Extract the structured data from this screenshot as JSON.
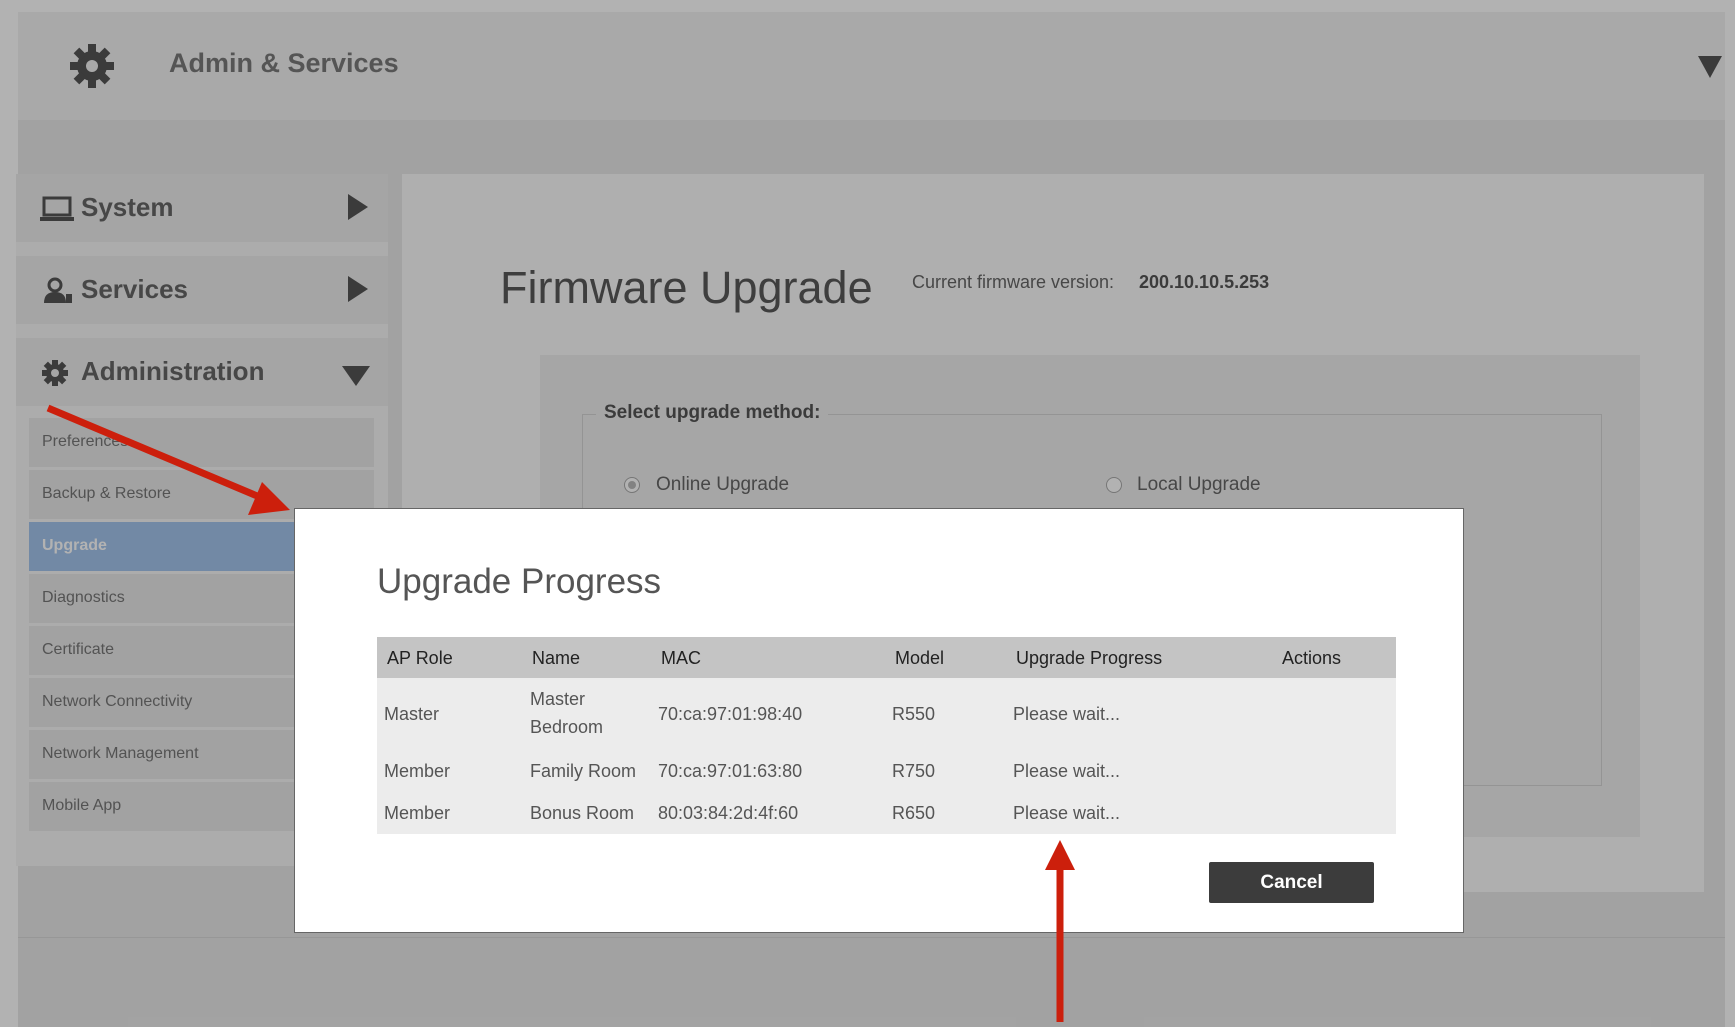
{
  "header": {
    "title": "Admin & Services",
    "icon": "gear-icon"
  },
  "sidebar": {
    "sections": [
      {
        "label": "System",
        "icon": "laptop-icon",
        "expanded": false
      },
      {
        "label": "Services",
        "icon": "services-icon",
        "expanded": false
      },
      {
        "label": "Administration",
        "icon": "gear-icon",
        "expanded": true
      }
    ],
    "admin_items": [
      {
        "label": "Preferences"
      },
      {
        "label": "Backup & Restore"
      },
      {
        "label": "Upgrade",
        "active": true
      },
      {
        "label": "Diagnostics"
      },
      {
        "label": "Certificate"
      },
      {
        "label": "Network Connectivity"
      },
      {
        "label": "Network Management"
      },
      {
        "label": "Mobile App"
      }
    ]
  },
  "main": {
    "title": "Firmware Upgrade",
    "version_label": "Current firmware version:",
    "version_value": "200.10.10.5.253",
    "method_legend": "Select upgrade method:",
    "methods": [
      {
        "label": "Online Upgrade",
        "selected": true
      },
      {
        "label": "Local Upgrade",
        "selected": false
      }
    ]
  },
  "modal": {
    "title": "Upgrade Progress",
    "columns": [
      "AP Role",
      "Name",
      "MAC",
      "Model",
      "Upgrade Progress",
      "Actions"
    ],
    "rows": [
      {
        "role": "Master",
        "name_line1": "Master",
        "name_line2": "Bedroom",
        "mac": "70:ca:97:01:98:40",
        "model": "R550",
        "progress": "Please wait...",
        "actions": ""
      },
      {
        "role": "Member",
        "name_line1": "Family Room",
        "name_line2": "",
        "mac": "70:ca:97:01:63:80",
        "model": "R750",
        "progress": "Please wait...",
        "actions": ""
      },
      {
        "role": "Member",
        "name_line1": "Bonus Room",
        "name_line2": "",
        "mac": "80:03:84:2d:4f:60",
        "model": "R650",
        "progress": "Please wait...",
        "actions": ""
      }
    ],
    "cancel_label": "Cancel"
  },
  "colors": {
    "active_item": "#a4c4ec",
    "overlay": "rgba(0,0,0,0.3)",
    "cancel_button": "#3c3c3c",
    "annotation_arrow": "#cc1f0c"
  }
}
